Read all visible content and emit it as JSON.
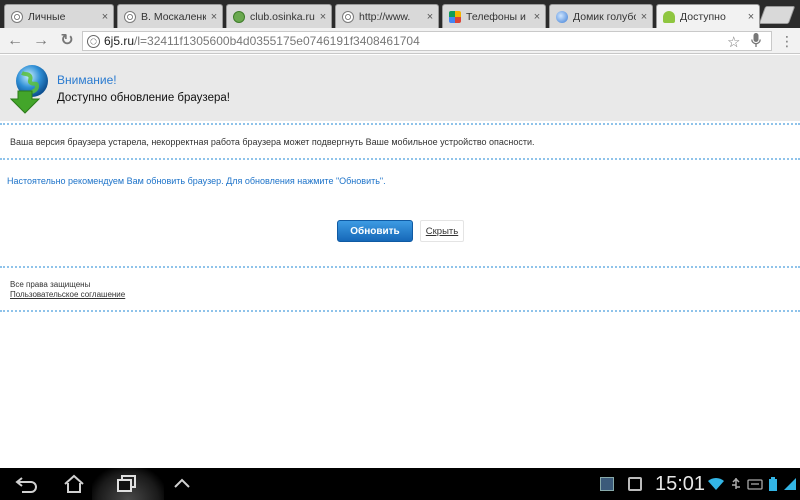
{
  "tabs": [
    {
      "label": "Личные",
      "icon": "globe-icon"
    },
    {
      "label": "В. Москаленко",
      "icon": "globe-icon"
    },
    {
      "label": "club.osinka.ru",
      "icon": "green-favicon-icon"
    },
    {
      "label": "http://www.",
      "icon": "globe-icon"
    },
    {
      "label": "Телефоны и",
      "icon": "colorful-favicon-icon"
    },
    {
      "label": "Домик голубой",
      "icon": "blue-bird-favicon-icon"
    },
    {
      "label": "Доступно",
      "icon": "android-favicon-icon"
    }
  ],
  "tab_close": "×",
  "toolbar": {
    "url_host": "6j5.ru",
    "url_path": "/l=32411f1305600b4d0355175e0746191f3408461704"
  },
  "notice": {
    "title": "Внимание!",
    "subtitle": "Доступно обновление браузера!"
  },
  "content": {
    "warning": "Ваша версия браузера устарела, некорректная работа браузера может подвергнуть Ваше мобильное устройство опасности.",
    "recommend": "Настоятельно рекомендуем Вам обновить браузер. Для обновления нажмите \"Обновить\".",
    "update_button": "Обновить",
    "hide_button": "Скрыть"
  },
  "footer": {
    "rights": "Все права защищены",
    "agreement": "Пользовательское соглашение"
  },
  "system_bar": {
    "clock": "15:01"
  },
  "colors": {
    "accent": "#2a7bd0",
    "button": "#1d73c9",
    "divider": "#8fc3ea"
  }
}
